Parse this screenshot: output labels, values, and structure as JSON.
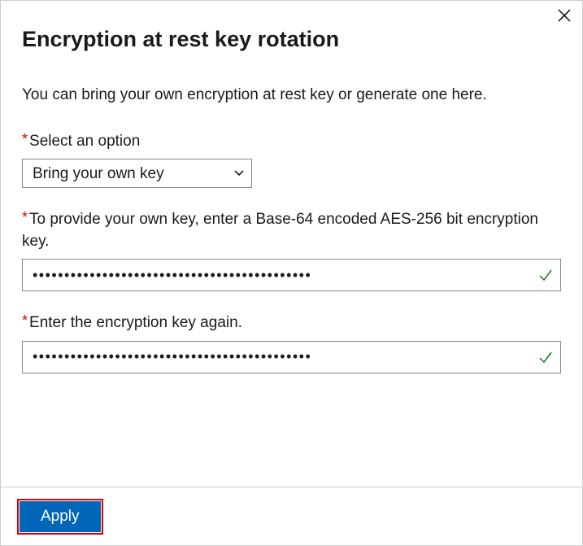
{
  "header": {
    "title": "Encryption at rest key rotation"
  },
  "description": "You can bring your own encryption at rest key or generate one here.",
  "fields": {
    "option": {
      "label": "Select an option",
      "selected": "Bring your own key"
    },
    "key": {
      "label": "To provide your own key, enter a Base-64 encoded AES-256 bit encryption key.",
      "value": "••••••••••••••••••••••••••••••••••••••••••••"
    },
    "key_confirm": {
      "label": "Enter the encryption key again.",
      "value": "••••••••••••••••••••••••••••••••••••••••••••"
    }
  },
  "footer": {
    "apply_label": "Apply"
  }
}
